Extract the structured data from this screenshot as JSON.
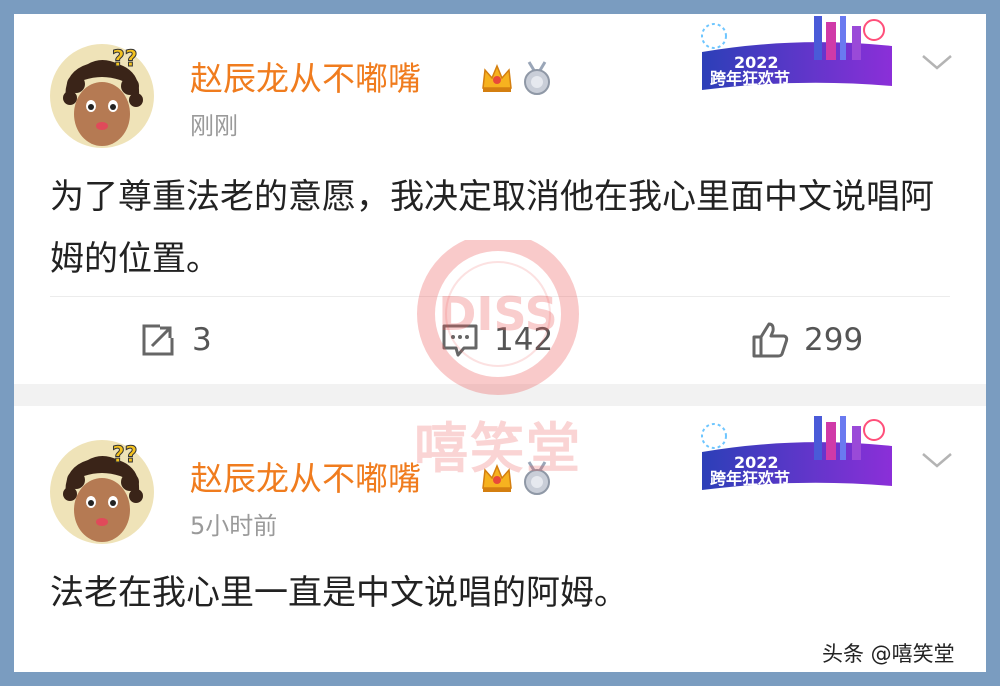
{
  "colors": {
    "accent": "#f07c1e",
    "muted": "#9a9a9a",
    "frame": "#7a9cc0",
    "watermark": "#ec5a5a"
  },
  "posts": [
    {
      "username": "赵辰龙从不嘟嘴",
      "timestamp": "刚刚",
      "text": "为了尊重法老的意愿，我决定取消他在我心里面中文说唱阿姆的位置。",
      "banner_year": "2022",
      "banner_text": "跨年狂欢节",
      "reposts": "3",
      "comments": "142",
      "likes": "299"
    },
    {
      "username": "赵辰龙从不嘟嘴",
      "timestamp": "5小时前",
      "text": "法老在我心里一直是中文说唱的阿姆。",
      "banner_year": "2022",
      "banner_text": "跨年狂欢节"
    }
  ],
  "watermark": {
    "logo_text": "DISS",
    "name": "嘻笑堂"
  },
  "credit": "头条 @嘻笑堂"
}
